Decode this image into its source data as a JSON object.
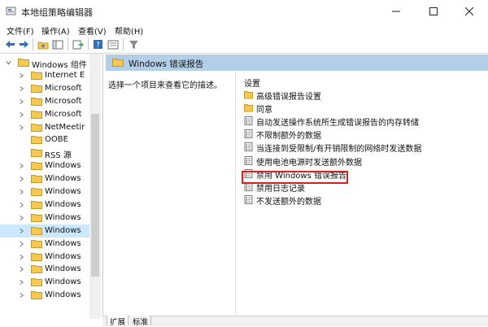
{
  "window": {
    "title": "本地组策略编辑器",
    "minimize_icon": "minimize-icon",
    "maximize_icon": "maximize-icon",
    "close_icon": "close-icon"
  },
  "menu": {
    "items": [
      "文件(F)",
      "操作(A)",
      "查看(V)",
      "帮助(H)"
    ]
  },
  "toolbar": {
    "icons": [
      "back-arrow-icon",
      "forward-arrow-icon",
      "up-folder-icon",
      "show-hide-tree-icon",
      "export-list-icon",
      "help-icon",
      "properties-icon",
      "filter-icon"
    ]
  },
  "tree": {
    "items": [
      {
        "label": "Windows 组件",
        "expanded": true
      },
      {
        "label": "Internet E"
      },
      {
        "label": "Microsoft"
      },
      {
        "label": "Microsoft"
      },
      {
        "label": "Microsoft"
      },
      {
        "label": "NetMeetir"
      },
      {
        "label": "OOBE"
      },
      {
        "label": "RSS 源"
      },
      {
        "label": "Windows"
      },
      {
        "label": "Windows"
      },
      {
        "label": "Windows"
      },
      {
        "label": "Windows"
      },
      {
        "label": "Windows"
      },
      {
        "label": "Windows",
        "selected": true
      },
      {
        "label": "Windows"
      },
      {
        "label": "Windows"
      },
      {
        "label": "Windows"
      },
      {
        "label": "Windows"
      },
      {
        "label": "Windows"
      }
    ]
  },
  "content": {
    "header": "Windows 错误报告",
    "description": "选择一个项目来查看它的描述。",
    "settings_heading": "设置",
    "items": [
      {
        "label": "高级错误报告设置",
        "type": "folder"
      },
      {
        "label": "同意",
        "type": "folder"
      },
      {
        "label": "自动发送操作系统所生成错误报告的内存转储",
        "type": "setting"
      },
      {
        "label": "不限制额外的数据",
        "type": "setting"
      },
      {
        "label": "当连接到受限制/有开销限制的网络时发送数据",
        "type": "setting"
      },
      {
        "label": "使用电池电源时发送额外数据",
        "type": "setting"
      },
      {
        "label": "禁用 Windows 错误报告",
        "type": "setting",
        "highlighted": true
      },
      {
        "label": "禁用日志记录",
        "type": "setting"
      },
      {
        "label": "不发送额外的数据",
        "type": "setting"
      }
    ]
  },
  "tabs": {
    "items": [
      {
        "label": "扩展",
        "active": true
      },
      {
        "label": "标准",
        "active": false
      }
    ]
  },
  "colors": {
    "header_bg": "#b3cfe8",
    "selected_bg": "#cce8ff",
    "highlight_border": "#d32020",
    "folder_yellow": "#f6c955"
  }
}
